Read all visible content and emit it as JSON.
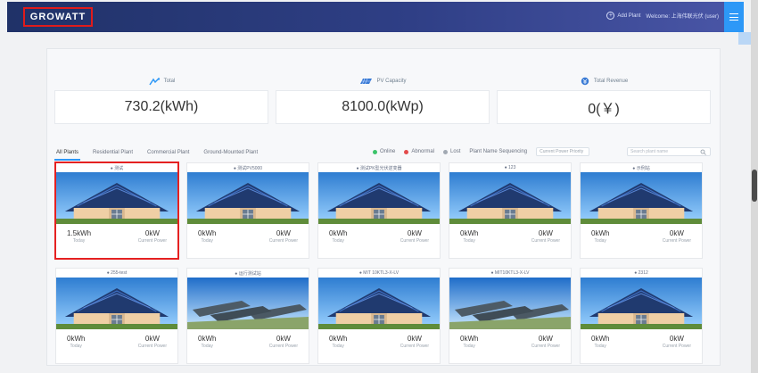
{
  "header": {
    "logo": "GROWATT",
    "actions": [
      {
        "label": "Add Plant",
        "icon": "plus-icon"
      },
      {
        "label": "Welcome: 上海伟联光伏 (user)",
        "icon": "user-icon"
      }
    ]
  },
  "stats": [
    {
      "label": "Total",
      "value": "730.2(kWh)",
      "icon": "power-icon"
    },
    {
      "label": "PV Capacity",
      "value": "8100.0(kWp)",
      "icon": "solar-panel-icon"
    },
    {
      "label": "Total Revenue",
      "value": "0(￥)",
      "icon": "revenue-icon"
    }
  ],
  "tabs": [
    "All Plants",
    "Residential Plant",
    "Commercial Plant",
    "Ground-Mounted Plant"
  ],
  "filters": {
    "legend": [
      {
        "label": "Online",
        "color": "#3cc46a"
      },
      {
        "label": "Abnormal",
        "color": "#e34b4b"
      },
      {
        "label": "Lost",
        "color": "#a2a9b3"
      }
    ],
    "sort_label": "Plant Name Sequencing",
    "select_value": "Current Power Priority",
    "search_placeholder": "Search plant name"
  },
  "plants": [
    {
      "name": "● 测试",
      "today": "1.5kWh",
      "today_label": "Today",
      "power": "0kW",
      "power_label": "Current Power",
      "image": "house",
      "selected": true
    },
    {
      "name": "● 测试PV5000",
      "today": "0kWh",
      "today_label": "Today",
      "power": "0kW",
      "power_label": "Current Power",
      "image": "house",
      "selected": false
    },
    {
      "name": "● 测试PK型光伏逆变器",
      "today": "0kWh",
      "today_label": "Today",
      "power": "0kW",
      "power_label": "Current Power",
      "image": "house",
      "selected": false
    },
    {
      "name": "● 123",
      "today": "0kWh",
      "today_label": "Today",
      "power": "0kW",
      "power_label": "Current Power",
      "image": "house",
      "selected": false
    },
    {
      "name": "● 示例站",
      "today": "0kWh",
      "today_label": "Today",
      "power": "0kW",
      "power_label": "Current Power",
      "image": "house",
      "selected": false
    },
    {
      "name": "● 255-test",
      "today": "0kWh",
      "today_label": "Today",
      "power": "0kW",
      "power_label": "Current Power",
      "image": "house",
      "selected": false
    },
    {
      "name": "● 运行测试站",
      "today": "0kWh",
      "today_label": "Today",
      "power": "0kW",
      "power_label": "Current Power",
      "image": "field",
      "selected": false
    },
    {
      "name": "● MIT 10KTL3-X-LV",
      "today": "0kWh",
      "today_label": "Today",
      "power": "0kW",
      "power_label": "Current Power",
      "image": "house",
      "selected": false
    },
    {
      "name": "● MIT10KTL3-X-LV",
      "today": "0kWh",
      "today_label": "Today",
      "power": "0kW",
      "power_label": "Current Power",
      "image": "field",
      "selected": false
    },
    {
      "name": "● 2312",
      "today": "0kWh",
      "today_label": "Today",
      "power": "0kW",
      "power_label": "Current Power",
      "image": "house",
      "selected": false
    }
  ]
}
